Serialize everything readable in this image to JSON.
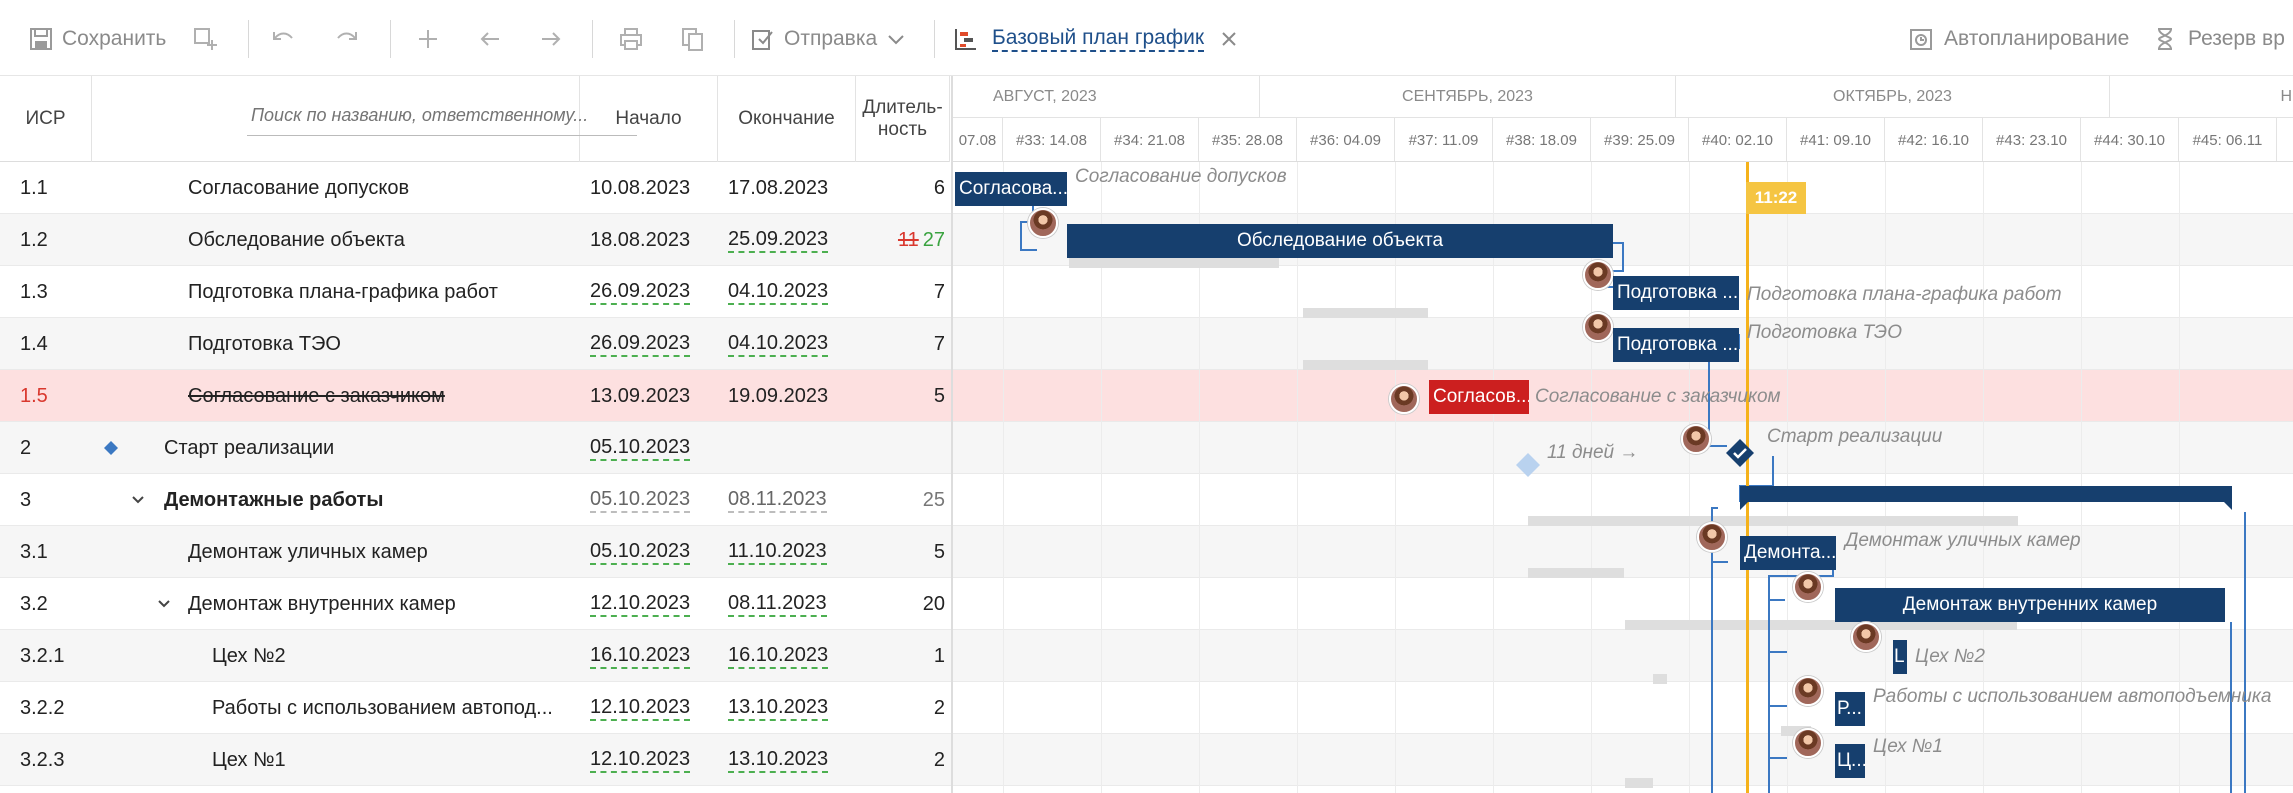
{
  "toolbar": {
    "save_label": "Сохранить",
    "send_label": "Отправка",
    "baseline_label": "Базовый план график",
    "autoplan_label": "Автопланирование",
    "reserve_label": "Резерв вр"
  },
  "grid": {
    "headers": {
      "wbs": "ИСР",
      "search_placeholder": "Поиск по названию, ответственному...",
      "start": "Начало",
      "end": "Окончание",
      "duration": "Длитель-ность"
    },
    "rows": [
      {
        "wbs": "1.1",
        "name": "Согласование допусков",
        "start": "10.08.2023",
        "end": "17.08.2023",
        "duration": "6"
      },
      {
        "wbs": "1.2",
        "name": "Обследование объекта",
        "start": "18.08.2023",
        "end": "25.09.2023",
        "duration_old": "11",
        "duration": "27"
      },
      {
        "wbs": "1.3",
        "name": "Подготовка плана-графика работ",
        "start": "26.09.2023",
        "end": "04.10.2023",
        "duration": "7"
      },
      {
        "wbs": "1.4",
        "name": "Подготовка ТЭО",
        "start": "26.09.2023",
        "end": "04.10.2023",
        "duration": "7"
      },
      {
        "wbs": "1.5",
        "name": "Согласование с заказчиком",
        "start": "13.09.2023",
        "end": "19.09.2023",
        "duration": "5"
      },
      {
        "wbs": "2",
        "name": "Старт реализации",
        "start": "05.10.2023",
        "end": "",
        "duration": ""
      },
      {
        "wbs": "3",
        "name": "Демонтажные работы",
        "start": "05.10.2023",
        "end": "08.11.2023",
        "duration": "25"
      },
      {
        "wbs": "3.1",
        "name": "Демонтаж уличных камер",
        "start": "05.10.2023",
        "end": "11.10.2023",
        "duration": "5"
      },
      {
        "wbs": "3.2",
        "name": "Демонтаж внутренних камер",
        "start": "12.10.2023",
        "end": "08.11.2023",
        "duration": "20"
      },
      {
        "wbs": "3.2.1",
        "name": "Цех №2",
        "start": "16.10.2023",
        "end": "16.10.2023",
        "duration": "1"
      },
      {
        "wbs": "3.2.2",
        "name": "Работы с использованием автопод...",
        "start": "12.10.2023",
        "end": "13.10.2023",
        "duration": "2"
      },
      {
        "wbs": "3.2.3",
        "name": "Цех №1",
        "start": "12.10.2023",
        "end": "13.10.2023",
        "duration": "2"
      }
    ]
  },
  "gantt": {
    "months": [
      "АВГУСТ, 2023",
      "СЕНТЯБРЬ, 2023",
      "ОКТЯБРЬ, 2023",
      "Н"
    ],
    "weeks": [
      "07.08",
      "#33: 14.08",
      "#34: 21.08",
      "#35: 28.08",
      "#36: 04.09",
      "#37: 11.09",
      "#38: 18.09",
      "#39: 25.09",
      "#40: 02.10",
      "#41: 09.10",
      "#42: 16.10",
      "#43: 23.10",
      "#44: 30.10",
      "#45: 06.11"
    ],
    "today_label": "11:22",
    "bars": {
      "r1": "Согласова...",
      "r2": "Обследование объекта",
      "r3": "Подготовка ...",
      "r4": "Подготовка ...",
      "r5": "Согласов...",
      "r8": "Демонта...",
      "r9": "Демонтаж внутренних камер",
      "r10": "L",
      "r11": "Р...",
      "r12": "Ц..."
    },
    "labels": {
      "r1": "Согласование допусков",
      "r3": "Подготовка плана-графика работ",
      "r4": "Подготовка ТЭО",
      "r5": "Согласование с заказчиком",
      "r6_lag": "11 дней →",
      "r6": "Старт реализации",
      "r8": "Демонтаж уличных камер",
      "r10": "Цех №2",
      "r11": "Работы с использованием автоподъемника",
      "r12": "Цех №1"
    }
  }
}
